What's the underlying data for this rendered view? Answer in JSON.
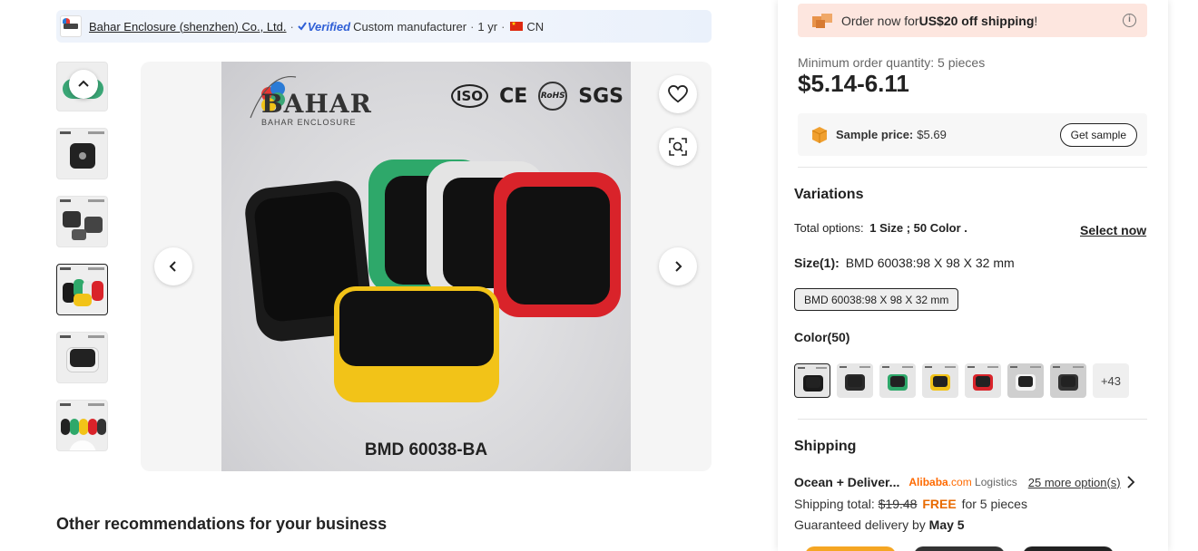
{
  "supplier": {
    "name": "Bahar Enclosure (shenzhen) Co., Ltd.",
    "verified": "Verified",
    "type": "Custom manufacturer",
    "years": "1 yr",
    "country": "CN",
    "sep": "·"
  },
  "gallery": {
    "main_image_text": {
      "brand": "BAHAR",
      "brand_sub": "BAHAR ENCLOSURE",
      "certs": [
        "ISO",
        "CE",
        "RoHS",
        "SGS"
      ],
      "model": "BMD 60038-BA"
    }
  },
  "order": {
    "promo_prefix": "Order now for ",
    "promo_amount": "US$20 off shipping",
    "promo_suffix": "!",
    "moq": "Minimum order quantity: 5 pieces",
    "price": "$5.14-6.11",
    "sample_label": "Sample price:",
    "sample_price": "$5.69",
    "get_sample": "Get sample"
  },
  "variations": {
    "title": "Variations",
    "total_prefix": "Total options:",
    "total_value": "1 Size ; 50 Color .",
    "select_now": "Select now",
    "size_label": "Size(1):",
    "size_value": "BMD 60038:98 X 98 X 32 mm",
    "size_chip": "BMD 60038:98 X 98 X 32 mm",
    "color_label": "Color(50)",
    "more_colors": "+43",
    "swatch_colors": [
      "#1a1a1a",
      "#2a2a2a",
      "#2ea86a",
      "#f2c318",
      "#d9232a",
      "#d8d8d8",
      "#333333"
    ]
  },
  "shipping": {
    "title": "Shipping",
    "method": "Ocean + Deliver...",
    "logistics_brand": "Alibaba",
    "logistics_domain": ".com",
    "logistics_suffix": " Logistics",
    "more_options": "25 more option(s)",
    "total_label": "Shipping total:",
    "old_price": "$19.48",
    "free": "FREE",
    "for_pieces": "for 5 pieces",
    "delivery_prefix": "Guaranteed delivery by",
    "delivery_date": "May 5"
  },
  "recommendations": {
    "title": "Other recommendations for your business"
  }
}
